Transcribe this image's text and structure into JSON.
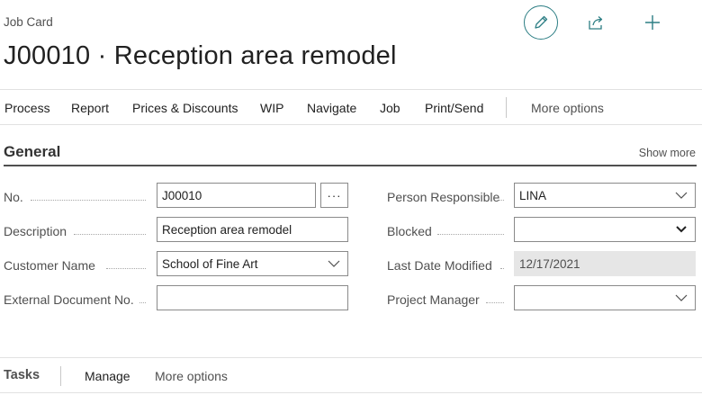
{
  "header": {
    "caption": "Job Card",
    "title": "J00010 · Reception area remodel",
    "accent_color": "#2c7e84"
  },
  "header_icons": [
    "pencil-edit-icon",
    "share-icon",
    "plus-new-icon"
  ],
  "actions": [
    {
      "label": "Process"
    },
    {
      "label": "Report"
    },
    {
      "label": "Prices & Discounts"
    },
    {
      "label": "WIP"
    },
    {
      "label": "Navigate"
    },
    {
      "label": "Job"
    },
    {
      "label": "Print/Send"
    },
    {
      "label": "More options"
    }
  ],
  "general": {
    "title": "General",
    "show_more": "Show more",
    "fields": {
      "no": {
        "label": "No.",
        "value": "J00010",
        "assist": "···"
      },
      "description": {
        "label": "Description",
        "value": "Reception area remodel"
      },
      "customer_name": {
        "label": "Customer Name",
        "value": "School of Fine Art"
      },
      "external_doc": {
        "label": "External Document No.",
        "value": ""
      },
      "person_responsible": {
        "label": "Person Responsible",
        "value": "LINA"
      },
      "blocked": {
        "label": "Blocked",
        "value": ""
      },
      "last_date_modified": {
        "label": "Last Date Modified",
        "value": "12/17/2021"
      },
      "project_manager": {
        "label": "Project Manager",
        "value": ""
      }
    }
  },
  "tasks": {
    "title": "Tasks",
    "actions": [
      {
        "label": "Manage"
      },
      {
        "label": "More options"
      }
    ]
  }
}
